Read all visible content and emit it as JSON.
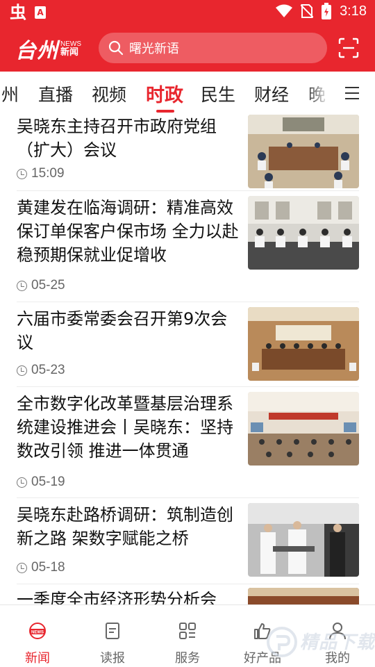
{
  "status_bar": {
    "time": "3:18"
  },
  "header": {
    "logo_main": "台州",
    "logo_en": "NEWS",
    "logo_cn": "新闻",
    "search_placeholder": "曙光新语",
    "accent_color": "#e8262e"
  },
  "tabs": {
    "items": [
      {
        "label": "州"
      },
      {
        "label": "直播"
      },
      {
        "label": "视频"
      },
      {
        "label": "时政"
      },
      {
        "label": "民生"
      },
      {
        "label": "财经"
      },
      {
        "label": "晚"
      }
    ],
    "active": "时政"
  },
  "news": [
    {
      "title": "吴晓东主持召开市政府党组（扩大）会议",
      "time": "15:09"
    },
    {
      "title": "黄建发在临海调研：精准高效保订单保客户保市场 全力以赴稳预期保就业促增收",
      "time": "05-25"
    },
    {
      "title": "六届市委常委会召开第9次会议",
      "time": "05-23"
    },
    {
      "title": "全市数字化改革暨基层治理系统建设推进会丨吴晓东：坚持数改引领 推进一体贯通",
      "time": "05-19"
    },
    {
      "title": "吴晓东赴路桥调研：筑制造创新之路 架数字赋能之桥",
      "time": "05-18"
    },
    {
      "title": "一季度全市经济形势分析会",
      "time": ""
    }
  ],
  "bottom_nav": [
    {
      "label": "新闻",
      "icon": "news-icon",
      "active": true
    },
    {
      "label": "读报",
      "icon": "newspaper-icon",
      "active": false
    },
    {
      "label": "服务",
      "icon": "services-grid-icon",
      "active": false
    },
    {
      "label": "好产品",
      "icon": "thumbs-up-icon",
      "active": false
    },
    {
      "label": "我的",
      "icon": "user-icon",
      "active": false
    }
  ],
  "watermark": {
    "text": "精品下载"
  }
}
